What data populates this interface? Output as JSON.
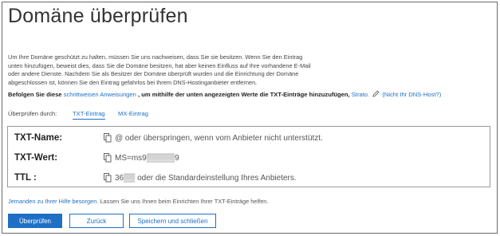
{
  "page": {
    "title": "Domäne überprüfen",
    "intro": "Um Ihre Domäne geschützt zu halten, müssen Sie uns nachweisen, dass Sie sie besitzen. Wenn Sie den Eintrag unten hinzufügen, beweist dies, dass Sie die Domäne besitzen, hat aber keinen Einfluss auf Ihre vorhandene E-Mail oder andere Dienste. Nachdem Sie als Besitzer der Domäne überprüft wurden und die Einrichtung der Domäne abgeschlossen ist, können Sie den Eintrag gefahrlos bei Ihrem DNS-Hostinganbieter entfernen."
  },
  "instructions": {
    "prefix": "Befolgen Sie diese",
    "link": "schrittweisen Anweisungen",
    "suffix": ", um mithilfe der unten angezeigten Werte die TXT-Einträge hinzuzufügen,",
    "provider": "Strato.",
    "provider_change": "(Nicht Ihr DNS-Host?)"
  },
  "verify": {
    "label": "Überprüfen durch:",
    "tabs": [
      {
        "label": "TXT-Eintrag",
        "active": true
      },
      {
        "label": "MX-Eintrag",
        "active": false
      }
    ]
  },
  "records": [
    {
      "key": "TXT-Name:",
      "value": "@ oder überspringen, wenn vom Anbieter nicht unterstützt."
    },
    {
      "key": "TXT-Wert:",
      "value": "MS=ms9▒▒▒▒▒9"
    },
    {
      "key": "TTL :",
      "value": "36▒▒ oder die Standardeinstellung Ihres Anbieters."
    }
  ],
  "help": {
    "link": "Jemanden zu Ihrer Hilfe besorgen.",
    "text": " Lassen Sie uns Ihnen beim Einrichten Ihrer TXT-Einträge helfen."
  },
  "buttons": {
    "verify": "Überprüfen",
    "back": "Zurück",
    "save_close": "Speichern und schließen"
  },
  "colors": {
    "accent": "#1f6fc5",
    "border": "#9a9a9a"
  }
}
